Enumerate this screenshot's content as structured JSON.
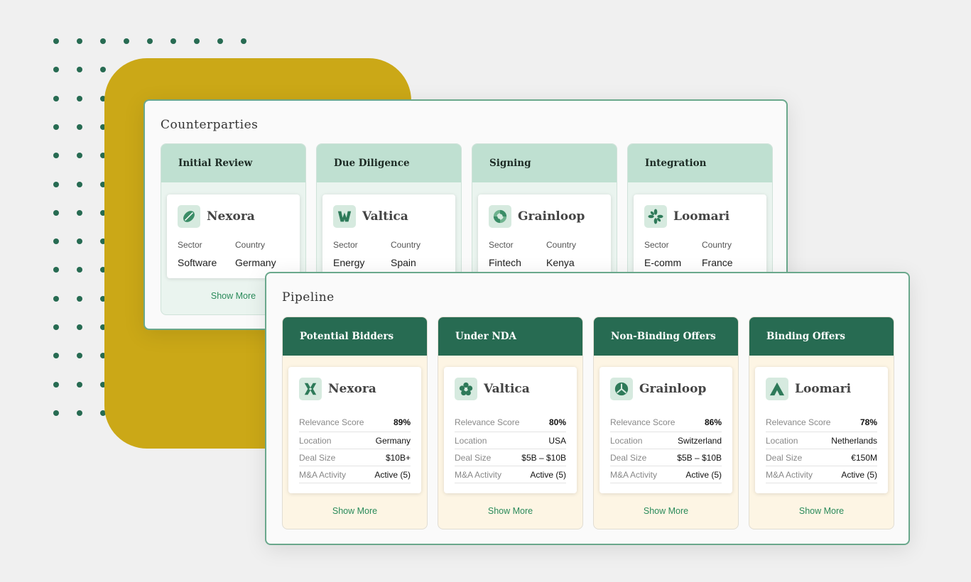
{
  "counterparties": {
    "title": "Counterparties",
    "columns": [
      {
        "stage": "Initial Review",
        "company": "Nexora",
        "icon": "leaf-icon",
        "sector_label": "Sector",
        "country_label": "Country",
        "sector": "Software",
        "country": "Germany",
        "show_more": "Show More"
      },
      {
        "stage": "Due Diligence",
        "company": "Valtica",
        "icon": "w-mark-icon",
        "sector_label": "Sector",
        "country_label": "Country",
        "sector": "Energy",
        "country": "Spain"
      },
      {
        "stage": "Signing",
        "company": "Grainloop",
        "icon": "swirl-icon",
        "sector_label": "Sector",
        "country_label": "Country",
        "sector": "Fintech",
        "country": "Kenya"
      },
      {
        "stage": "Integration",
        "company": "Loomari",
        "icon": "pinwheel-icon",
        "sector_label": "Sector",
        "country_label": "Country",
        "sector": "E-comm",
        "country": "France"
      }
    ]
  },
  "pipeline": {
    "title": "Pipeline",
    "columns": [
      {
        "stage": "Potential Bidders",
        "company": "Nexora",
        "icon": "diamond-chain-icon",
        "rows": [
          [
            "Relevance Score",
            "89%"
          ],
          [
            "Location",
            "Germany"
          ],
          [
            "Deal Size",
            "$10B+"
          ],
          [
            "M&A Activity",
            "Active (5)"
          ]
        ],
        "show_more": "Show More"
      },
      {
        "stage": "Under NDA",
        "company": "Valtica",
        "icon": "flower-icon",
        "rows": [
          [
            "Relevance Score",
            "80%"
          ],
          [
            "Location",
            "USA"
          ],
          [
            "Deal Size",
            "$5B – $10B"
          ],
          [
            "M&A Activity",
            "Active (5)"
          ]
        ],
        "show_more": "Show More"
      },
      {
        "stage": "Non-Binding Offers",
        "company": "Grainloop",
        "icon": "tri-leaf-icon",
        "rows": [
          [
            "Relevance Score",
            "86%"
          ],
          [
            "Location",
            "Switzerland"
          ],
          [
            "Deal Size",
            "$5B – $10B"
          ],
          [
            "M&A Activity",
            "Active (5)"
          ]
        ],
        "show_more": "Show More"
      },
      {
        "stage": "Binding Offers",
        "company": "Loomari",
        "icon": "mountain-icon",
        "rows": [
          [
            "Relevance Score",
            "78%"
          ],
          [
            "Location",
            "Netherlands"
          ],
          [
            "Deal Size",
            "€150M"
          ],
          [
            "M&A Activity",
            "Active (5)"
          ]
        ],
        "show_more": "Show More"
      }
    ]
  },
  "colors": {
    "accent": "#276b52",
    "gold": "#cba817",
    "mint": "#bfe0d1"
  }
}
